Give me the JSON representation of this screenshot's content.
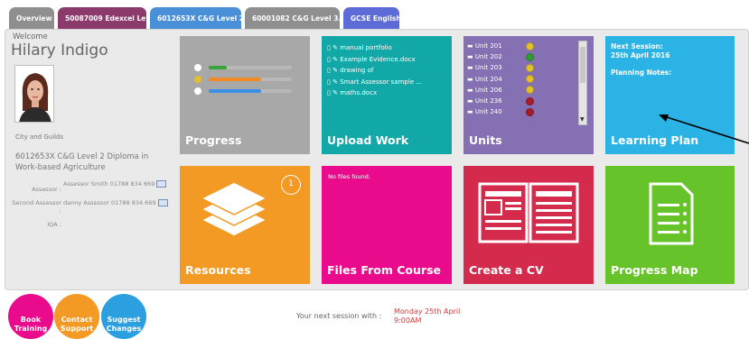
{
  "tabs": [
    {
      "label": "Overview",
      "color": "#8f8f8f"
    },
    {
      "label": "50087009 Edexcel Lev...",
      "color": "#8b3a6b"
    },
    {
      "label": "6012653X C&G Level 2...",
      "color": "#4a90d9"
    },
    {
      "label": "60001082 C&G Level 3...",
      "color": "#8f8f8f"
    },
    {
      "label": "GCSE English",
      "color": "#5c6bd6"
    }
  ],
  "profile": {
    "welcome": "Welcome",
    "name": "Hilary Indigo",
    "organisation": "City and Guilds",
    "qualification": "6012653X C&G Level 2 Diploma in Work-based Agriculture",
    "assessor_label": "Assessor :",
    "assessor_value": "Assessor Smith 01788 834 669",
    "second_assessor_label": "Second Assessor :",
    "second_assessor_value": "danny Assessor 01788 834 669",
    "iqa_label": "IQA :",
    "iqa_value": ""
  },
  "tiles": {
    "progress": {
      "label": "Progress",
      "color": "#a8a8a8"
    },
    "upload": {
      "label": "Upload Work",
      "color": "#13a8a8",
      "files": [
        "manual portfolio",
        "Example Evidence.docx",
        "drawing of",
        "Smart Assessor sample ...",
        "maths.docx"
      ]
    },
    "units": {
      "label": "Units",
      "color": "#8470b3",
      "items": [
        {
          "name": "Unit 201",
          "status": "#e3c12c"
        },
        {
          "name": "Unit 202",
          "status": "#2f9e2f"
        },
        {
          "name": "Unit 203",
          "status": "#e3c12c"
        },
        {
          "name": "Unit 204",
          "status": "#e3c12c"
        },
        {
          "name": "Unit 206",
          "status": "#e3c12c"
        },
        {
          "name": "Unit 236",
          "status": "#a51d2a"
        },
        {
          "name": "Unit 240",
          "status": "#a51d2a"
        }
      ]
    },
    "learning_plan": {
      "label": "Learning Plan",
      "color": "#2bb3e6",
      "next_session_label": "Next Session:",
      "next_session_date": "25th April 2016",
      "planning_notes_label": "Planning Notes:"
    },
    "resources": {
      "label": "Resources",
      "color": "#f39a24",
      "badge": "1"
    },
    "files_from_course": {
      "label": "Files From Course",
      "color": "#ea0b8c",
      "empty_text": "No files found."
    },
    "create_cv": {
      "label": "Create a CV",
      "color": "#d42a4b"
    },
    "progress_map": {
      "label": "Progress Map",
      "color": "#66c42a"
    }
  },
  "bottom": {
    "book_training": "Book Training",
    "contact_support": "Contact Support",
    "suggest_changes": "Suggest Changes",
    "next_session_text": "Your next session with :",
    "next_session_date": "Monday 25th April",
    "next_session_time": "9:00AM"
  }
}
